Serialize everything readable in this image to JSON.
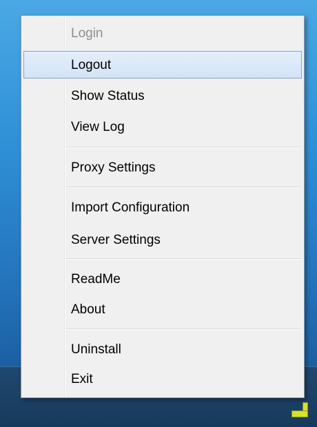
{
  "menu": {
    "items": [
      {
        "label": "Login",
        "enabled": false
      },
      {
        "label": "Logout",
        "enabled": true,
        "highlighted": true
      },
      {
        "label": "Show Status",
        "enabled": true
      },
      {
        "label": "View Log",
        "enabled": true
      },
      {
        "label": "Proxy Settings",
        "enabled": true
      },
      {
        "label": "Import Configuration",
        "enabled": true
      },
      {
        "label": "Server Settings",
        "enabled": true
      },
      {
        "label": "ReadMe",
        "enabled": true
      },
      {
        "label": "About",
        "enabled": true
      },
      {
        "label": "Uninstall",
        "enabled": true
      },
      {
        "label": "Exit",
        "enabled": true
      }
    ]
  },
  "tray": {
    "icon": "tray-app-icon"
  },
  "colors": {
    "menu_background": "#f0f0f0",
    "highlight_background": "#d9e6f7",
    "highlight_border": "#7ea3d1",
    "disabled_text": "#8d8d8d",
    "taskbar": "#1d4266",
    "desktop": "#2f8fd6"
  }
}
